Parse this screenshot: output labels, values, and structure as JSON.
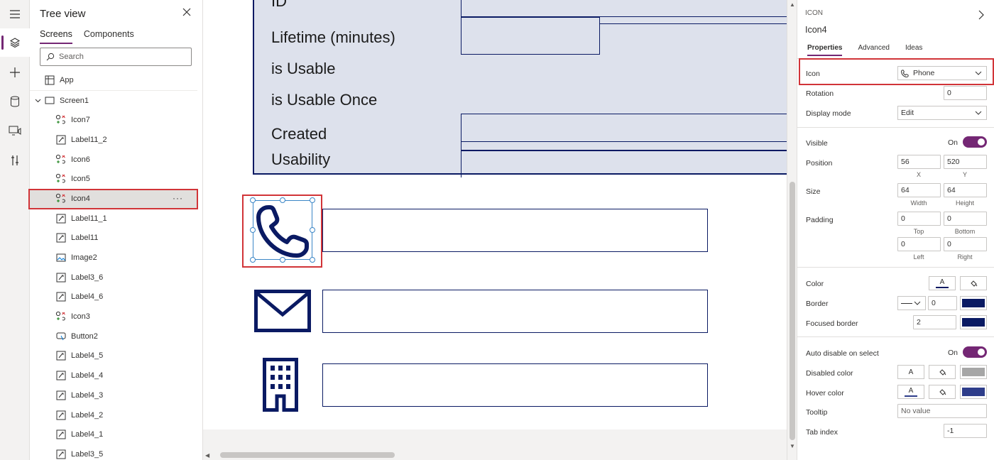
{
  "tree": {
    "title": "Tree view",
    "tabs": [
      {
        "label": "Screens"
      },
      {
        "label": "Components"
      }
    ],
    "search_placeholder": "Search",
    "app_label": "App",
    "screen_label": "Screen1",
    "items": [
      {
        "label": "Icon7",
        "kind": "icon"
      },
      {
        "label": "Label11_2",
        "kind": "label"
      },
      {
        "label": "Icon6",
        "kind": "icon"
      },
      {
        "label": "Icon5",
        "kind": "icon"
      },
      {
        "label": "Icon4",
        "kind": "icon"
      },
      {
        "label": "Label11_1",
        "kind": "label"
      },
      {
        "label": "Label11",
        "kind": "label"
      },
      {
        "label": "Image2",
        "kind": "image"
      },
      {
        "label": "Label3_6",
        "kind": "label"
      },
      {
        "label": "Label4_6",
        "kind": "label"
      },
      {
        "label": "Icon3",
        "kind": "icon"
      },
      {
        "label": "Button2",
        "kind": "button"
      },
      {
        "label": "Label4_5",
        "kind": "label"
      },
      {
        "label": "Label4_4",
        "kind": "label"
      },
      {
        "label": "Label4_3",
        "kind": "label"
      },
      {
        "label": "Label4_2",
        "kind": "label"
      },
      {
        "label": "Label4_1",
        "kind": "label"
      },
      {
        "label": "Label3_5",
        "kind": "label"
      }
    ],
    "selected_more": "···"
  },
  "canvas": {
    "labels": [
      "ID",
      "Lifetime (minutes)",
      "is Usable",
      "is Usable Once",
      "Created",
      "Usability"
    ],
    "colors": {
      "navy": "#0a1a63",
      "card": "#dde1ec"
    }
  },
  "props": {
    "type": "ICON",
    "name": "Icon4",
    "tabs": [
      {
        "label": "Properties"
      },
      {
        "label": "Advanced"
      },
      {
        "label": "Ideas"
      }
    ],
    "icon_label": "Icon",
    "icon_value": "Phone",
    "rotation_label": "Rotation",
    "rotation_value": "0",
    "display_mode_label": "Display mode",
    "display_mode_value": "Edit",
    "visible_label": "Visible",
    "visible_state": "On",
    "position_label": "Position",
    "position_x": "56",
    "position_y": "520",
    "x_caption": "X",
    "y_caption": "Y",
    "size_label": "Size",
    "size_width": "64",
    "size_height": "64",
    "width_caption": "Width",
    "height_caption": "Height",
    "padding_label": "Padding",
    "padding_top": "0",
    "padding_bottom": "0",
    "padding_left": "0",
    "padding_right": "0",
    "top_caption": "Top",
    "bottom_caption": "Bottom",
    "left_caption": "Left",
    "right_caption": "Right",
    "color_label": "Color",
    "border_label": "Border",
    "border_width": "0",
    "focused_border_label": "Focused border",
    "focused_border_value": "2",
    "auto_disable_label": "Auto disable on select",
    "auto_disable_state": "On",
    "disabled_color_label": "Disabled color",
    "hover_color_label": "Hover color",
    "tooltip_label": "Tooltip",
    "tooltip_placeholder": "No value",
    "tab_index_label": "Tab index",
    "tab_index_value": "-1",
    "text_glyph": "A",
    "colors": {
      "accent": "#742774",
      "navy": "#0a1a63",
      "disabled": "#a6a6a6",
      "hover": "#2e3d8a",
      "highlight": "#d13438"
    }
  }
}
